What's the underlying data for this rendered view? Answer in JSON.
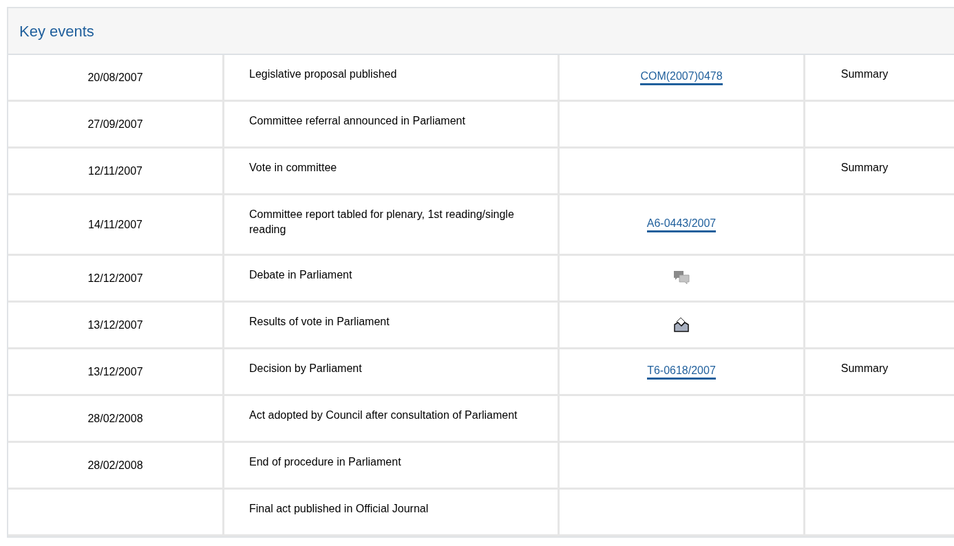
{
  "panel": {
    "title": "Key events"
  },
  "rows": [
    {
      "date": "20/08/2007",
      "event": "Legislative proposal published",
      "document": {
        "kind": "link",
        "text": "COM(2007)0478"
      },
      "summary": "Summary"
    },
    {
      "date": "27/09/2007",
      "event": "Committee referral announced in Parliament",
      "document": {
        "kind": "none"
      }
    },
    {
      "date": "12/11/2007",
      "event": "Vote in committee",
      "document": {
        "kind": "none"
      },
      "summary": "Summary"
    },
    {
      "date": "14/11/2007",
      "event": "Committee report tabled for plenary, 1st reading/single reading",
      "document": {
        "kind": "link",
        "text": "A6-0443/2007"
      }
    },
    {
      "date": "12/12/2007",
      "event": "Debate in Parliament",
      "document": {
        "kind": "debate"
      }
    },
    {
      "date": "13/12/2007",
      "event": "Results of vote in Parliament",
      "document": {
        "kind": "vote"
      }
    },
    {
      "date": "13/12/2007",
      "event": "Decision by Parliament",
      "document": {
        "kind": "link",
        "text": "T6-0618/2007"
      },
      "summary": "Summary"
    },
    {
      "date": "28/02/2008",
      "event": "Act adopted by Council after consultation of Parliament",
      "document": {
        "kind": "none"
      }
    },
    {
      "date": "28/02/2008",
      "event": "End of procedure in Parliament",
      "document": {
        "kind": "none"
      }
    },
    {
      "event": "Final act published in Official Journal",
      "document": {
        "kind": "none"
      }
    }
  ]
}
